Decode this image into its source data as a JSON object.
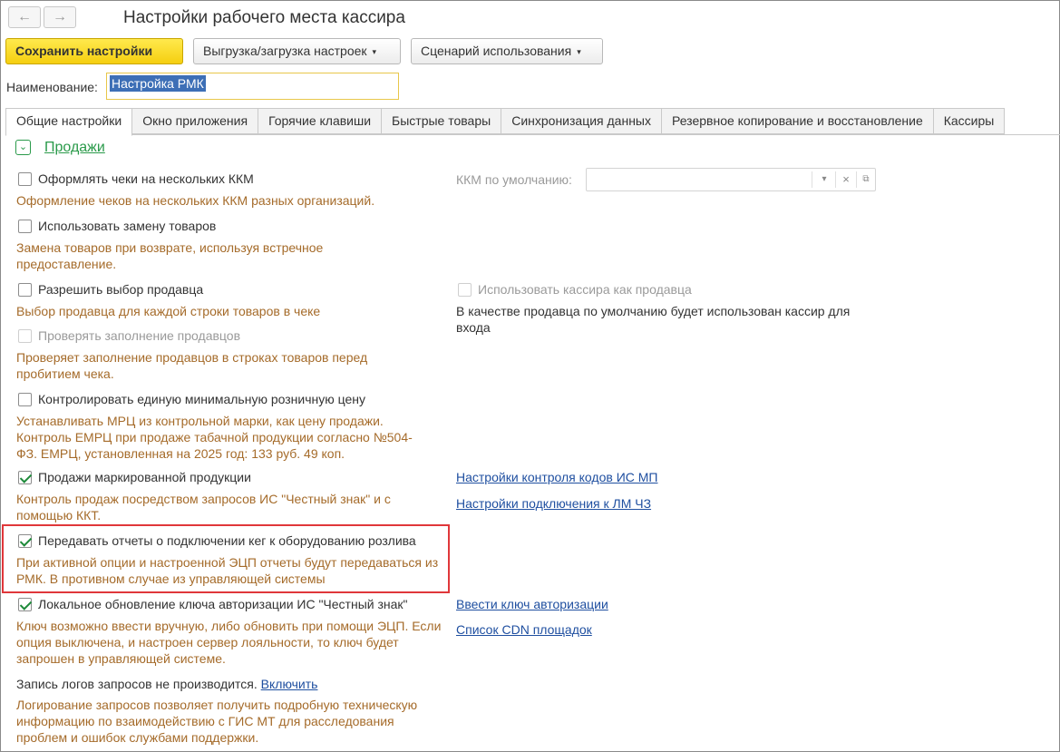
{
  "header": {
    "back_icon": "←",
    "forward_icon": "→",
    "title": "Настройки рабочего места кассира"
  },
  "toolbar": {
    "save_label": "Сохранить настройки",
    "export_label": "Выгрузка/загрузка настроек",
    "scenario_label": "Сценарий использования",
    "caret": "▾"
  },
  "name_field": {
    "label": "Наименование:",
    "value": "Настройка РМК"
  },
  "tabs": [
    {
      "label": "Общие настройки"
    },
    {
      "label": "Окно приложения"
    },
    {
      "label": "Горячие клавиши"
    },
    {
      "label": "Быстрые товары"
    },
    {
      "label": "Синхронизация данных"
    },
    {
      "label": "Резервное копирование и восстановление"
    },
    {
      "label": "Кассиры"
    }
  ],
  "section": {
    "title": "Продажи",
    "toggle_icon": "⌄"
  },
  "settings": {
    "multi_kkm": {
      "label": "Оформлять чеки на нескольких ККМ",
      "desc": "Оформление чеков на нескольких ККМ разных организаций."
    },
    "default_kkm": {
      "label": "ККМ по умолчанию:",
      "value": "",
      "dropdown_icon": "▾",
      "clear_icon": "×",
      "open_icon": "⧉"
    },
    "replace_goods": {
      "label": "Использовать замену товаров",
      "desc": "Замена товаров при возврате, используя встречное предоставление."
    },
    "seller_choice": {
      "label": "Разрешить выбор продавца",
      "desc": "Выбор продавца для каждой строки товаров в чеке"
    },
    "cashier_as_seller": {
      "label": "Использовать кассира как продавца",
      "desc": "В качестве продавца по умолчанию будет использован кассир для входа"
    },
    "check_sellers": {
      "label": "Проверять заполнение продавцов",
      "desc": "Проверяет заполнение продавцов в строках товаров перед пробитием чека."
    },
    "min_price": {
      "label": "Контролировать единую минимальную розничную цену",
      "desc": "Устанавливать МРЦ из контрольной марки, как цену продажи. Контроль ЕМРЦ при продаже табачной продукции согласно №504-ФЗ. ЕМРЦ, установленная на 2025 год: 133 руб. 49 коп."
    },
    "marked_sales": {
      "label": "Продажи маркированной продукции",
      "desc": "Контроль продаж посредством запросов ИС \"Честный знак\" и с помощью ККТ.",
      "link1": "Настройки контроля кодов ИС МП",
      "link2": "Настройки подключения к ЛМ ЧЗ"
    },
    "keg_reports": {
      "label": "Передавать отчеты о подключении кег к оборудованию розлива",
      "desc": "При активной опции и настроенной ЭЦП отчеты будут передаваться из РМК. В противном случае из управляющей системы"
    },
    "auth_key": {
      "label": "Локальное обновление ключа авторизации ИС \"Честный знак\"",
      "desc": "Ключ возможно ввести вручную, либо обновить при помощи ЭЦП. Если опция выключена, и настроен сервер лояльности, то ключ будет запрошен в управляющей системе.",
      "link1": "Ввести ключ авторизации",
      "link2": "Список CDN площадок"
    },
    "logging": {
      "status": "Запись логов запросов не производится.",
      "enable_link": "Включить",
      "desc": "Логирование запросов позволяет получить подробную техническую информацию по взаимодействию с ГИС МТ для расследования проблем и ошибок службами поддержки."
    }
  }
}
